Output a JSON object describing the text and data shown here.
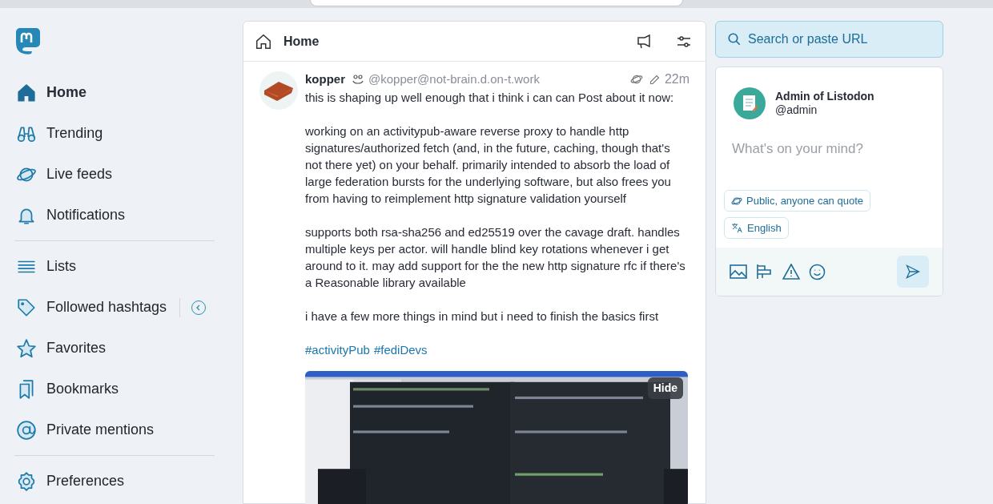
{
  "sidebar": {
    "groups": [
      [
        {
          "label": "Home",
          "kind": "home",
          "selected": true
        },
        {
          "label": "Trending",
          "kind": "binoculars",
          "selected": false
        },
        {
          "label": "Live feeds",
          "kind": "planet",
          "selected": false
        },
        {
          "label": "Notifications",
          "kind": "bell",
          "selected": false
        }
      ],
      [
        {
          "label": "Lists",
          "kind": "lists",
          "selected": false
        },
        {
          "label": "Followed hashtags",
          "kind": "tag",
          "selected": false,
          "expandable": true
        },
        {
          "label": "Favorites",
          "kind": "star",
          "selected": false
        },
        {
          "label": "Bookmarks",
          "kind": "bookmarks",
          "selected": false
        },
        {
          "label": "Private mentions",
          "kind": "at",
          "selected": false
        }
      ],
      [
        {
          "label": "Preferences",
          "kind": "gear",
          "selected": false
        }
      ]
    ]
  },
  "column": {
    "title": "Home"
  },
  "post": {
    "display_name": "kopper",
    "handle": "@kopper@not-brain.d.on-t.work",
    "time": "22m",
    "edited": true,
    "paragraphs": [
      "this is shaping up well enough that i think i can can Post about it now:",
      "working on an activitypub-aware reverse proxy to handle http signatures/authorized fetch (and, in the future, caching, though that's not there yet) on your behalf. primarily intended to absorb the load of large federation bursts for the underlying software, but also frees you from having to reimplement http signature validation yourself",
      "supports both rsa-sha256 and ed25519 over the cavage draft. handles multiple keys per actor. will handle blind key rotations whenever i get around to it. may add support for the the new http signature rfc if there's a Reasonable library available",
      "i have a few more things in mind but i need to finish the basics first"
    ],
    "hashtags": [
      "#activityPub",
      "#fediDevs"
    ],
    "media": {
      "kind": "picture",
      "hide_label": "Hide"
    }
  },
  "search": {
    "placeholder": "Search or paste URL"
  },
  "compose": {
    "name": "Admin of Listodon",
    "handle": "@admin",
    "placeholder": "What's on your mind?",
    "visibility": "Public, anyone can quote",
    "language": "English"
  }
}
